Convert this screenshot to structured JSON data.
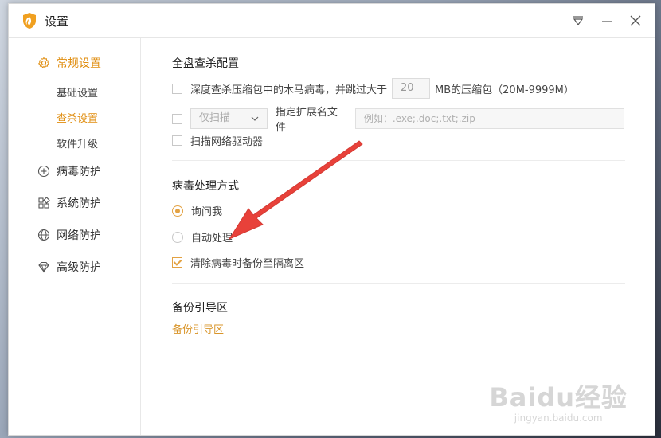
{
  "window": {
    "title": "设置"
  },
  "sidebar": {
    "groups": [
      {
        "label": "常规设置",
        "icon": "gear-icon",
        "active": true,
        "subitems": [
          {
            "label": "基础设置",
            "active": false
          },
          {
            "label": "查杀设置",
            "active": true
          },
          {
            "label": "软件升级",
            "active": false
          }
        ]
      },
      {
        "label": "病毒防护",
        "icon": "plus-circle-icon",
        "active": false
      },
      {
        "label": "系统防护",
        "icon": "grid-icon",
        "active": false
      },
      {
        "label": "网络防护",
        "icon": "globe-icon",
        "active": false
      },
      {
        "label": "高级防护",
        "icon": "diamond-icon",
        "active": false
      }
    ]
  },
  "full_scan": {
    "title": "全盘查杀配置",
    "deep_scan_label": "深度查杀压缩包中的木马病毒，并跳过大于",
    "size_value": "20",
    "size_suffix": "MB的压缩包（20M-9999M）",
    "scan_mode_value": "仅扫描",
    "ext_label": "指定扩展名文件",
    "ext_placeholder": "例如：.exe;.doc;.txt;.zip",
    "network_drive_label": "扫描网络驱动器"
  },
  "virus_handling": {
    "title": "病毒处理方式",
    "options": [
      {
        "label": "询问我",
        "selected": true
      },
      {
        "label": "自动处理",
        "selected": false
      }
    ],
    "backup_label": "清除病毒时备份至隔离区",
    "backup_checked": true
  },
  "boot_backup": {
    "title": "备份引导区",
    "link_label": "备份引导区"
  },
  "watermark": {
    "main": "Baidu经验",
    "sub": "jingyan.baidu.com"
  },
  "colors": {
    "accent": "#e3a243",
    "arrow": "#e8413a"
  }
}
